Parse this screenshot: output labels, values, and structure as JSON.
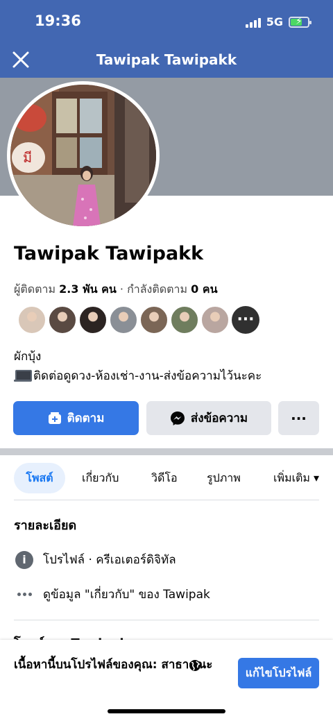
{
  "status_bar": {
    "time": "19:36",
    "network": "5G"
  },
  "header": {
    "title": "Tawipak Tawipakk"
  },
  "profile": {
    "name": "Tawipak Tawipakk",
    "followers_label": "ผู้ติดตาม",
    "followers_count": "2.3 พัน คน",
    "separator": "·",
    "following_label": "กำลังติดตาม",
    "following_count": "0 คน"
  },
  "friend_avatar_colors": [
    "#d9c7b8",
    "#5a4a42",
    "#2c2422",
    "#8a8f96",
    "#7b6656",
    "#6f7d5e",
    "#b9a6a0"
  ],
  "friend_more_label": "···",
  "bio": {
    "line1": "ผักบุ้ง",
    "line2": "ติดต่อดูดวง-ห้องเช่า-งาน-ส่งข้อความไว้นะคะ"
  },
  "actions": {
    "follow_label": "ติดตาม",
    "message_label": "ส่งข้อความ",
    "more_label": "···"
  },
  "tabs": [
    {
      "label": "โพสต์"
    },
    {
      "label": "เกี่ยวกับ"
    },
    {
      "label": "วิดีโอ"
    },
    {
      "label": "รูปภาพ"
    },
    {
      "label": "เพิ่มเติม ▾"
    }
  ],
  "details": {
    "title": "รายละเอียด",
    "profile_type": "โปรไฟล์ · ครีเอเตอร์ดิจิทัล",
    "about_link": "ดูข้อมูล \"เกี่ยวกับ\" ของ Tawipak"
  },
  "section_peek": "โพสต์ของ Tawipak",
  "bottom_bar": {
    "text": "เนื้อหานี้บนโปรไฟล์ของคุณ: สาธารณะ",
    "edit_label": "แก้ไขโปรไฟล์"
  },
  "colors": {
    "brand_blue": "#4267b2",
    "button_blue": "#3578e5",
    "tab_active_bg": "#e7f0fd"
  }
}
